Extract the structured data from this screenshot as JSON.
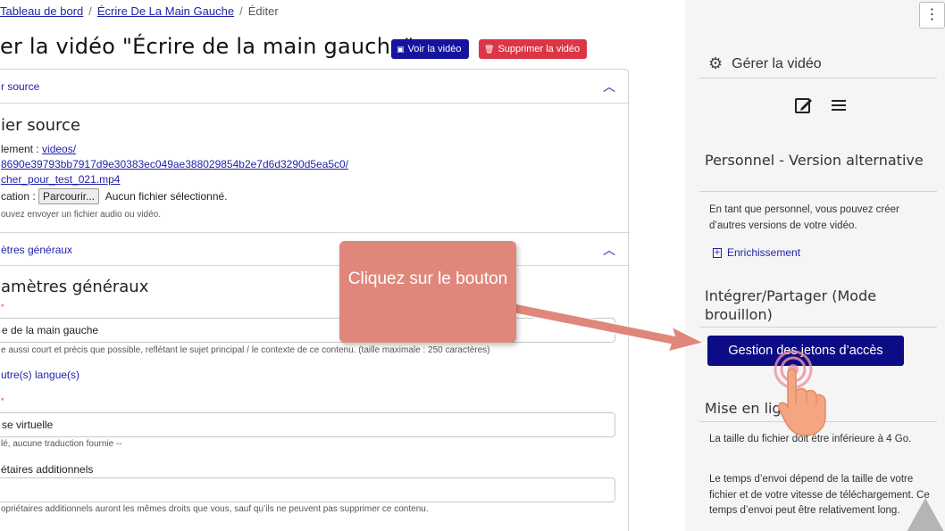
{
  "breadcrumb": {
    "home": "Tableau de bord",
    "video": "Écrire De La Main Gauche",
    "current": "Éditer"
  },
  "page": {
    "title": "er la vidéo \"Écrire de la main gauche\"",
    "view_button": "Voir la vidéo",
    "delete_button": "Supprimer la vidéo"
  },
  "source_section": {
    "accordion_label": "r source",
    "title": "ier source",
    "location_label": "lement :",
    "location_link_1": "videos/",
    "location_link_2": "8690e39793bb7917d9e30383ec049ae388029854b2e7d6d3290d5ea5c0/",
    "location_link_3": "cher_pour_test_021.mp4",
    "file_label": "cation :",
    "browse_button": "Parcourir...",
    "no_file": "Aucun fichier sélectionné.",
    "help": "ouvez envoyer un fichier audio ou vidéo."
  },
  "general_section": {
    "accordion_label": "ètres généraux",
    "title": "amètres généraux",
    "title_value": "e de la main gauche",
    "title_help": "e aussi court et précis que possible, reflétant le sujet principal / le contexte de ce contenu. (taille maximale : 250 caractères)",
    "lang_label": "utre(s) langue(s)",
    "lang_value": "se virtuelle",
    "lang_help": "lé, aucune traduction fournie --",
    "owners_label": "étaires additionnels",
    "owners_value": "",
    "owners_help": "opriétaires additionnels auront les mêmes droits que vous, sauf qu’ils ne peuvent pas supprimer ce contenu."
  },
  "sidebar": {
    "menu_icon": "⋮",
    "manage_title": "Gérer la vidéo",
    "staff_heading": "Personnel - Version alternative",
    "staff_text": "En tant que personnel, vous pouvez créer d’autres versions de votre vidéo.",
    "enrich_link": "Enrichissement",
    "embed_heading": "Intégrer/Partager (Mode brouillon)",
    "token_button": "Gestion des jetons d’accès",
    "online_heading": "Mise en ligne",
    "online_text_1": "La taille du fichier doit être inférieure à 4 Go.",
    "online_text_2": "Le temps d’envoi dépend de la taille de votre fichier et de votre vitesse de téléchargement. Ce temps d’envoi peut être relativement long."
  },
  "callout": {
    "text": "Cliquez sur le bouton"
  },
  "colors": {
    "primary": "#0c0c86",
    "danger": "#dc3545",
    "callout": "#e0877b",
    "link": "#1f1fa8"
  },
  "icons": {
    "view": "film-icon",
    "delete": "trash-icon",
    "manage": "gear-icon",
    "edit": "edit-icon",
    "list": "menu-icon",
    "enrich": "plus-square-icon",
    "hand": "pointer-hand-icon"
  }
}
